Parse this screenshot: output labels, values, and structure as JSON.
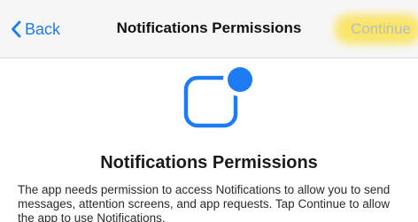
{
  "navbar": {
    "back_label": "Back",
    "title": "Notifications Permissions",
    "continue_label": "Continue"
  },
  "content": {
    "icon": "notification-badge-icon",
    "heading": "Notifications Permissions",
    "description": "The app needs permission to access Notifications to allow you to send messages, attention screens, and app requests. Tap Continue to allow the app to use Notifications."
  },
  "colors": {
    "accent": "#1d7cf2",
    "continue_disabled": "#b6bec9",
    "highlight": "#fbe35a",
    "navbar_bg": "#f6f6f7"
  }
}
